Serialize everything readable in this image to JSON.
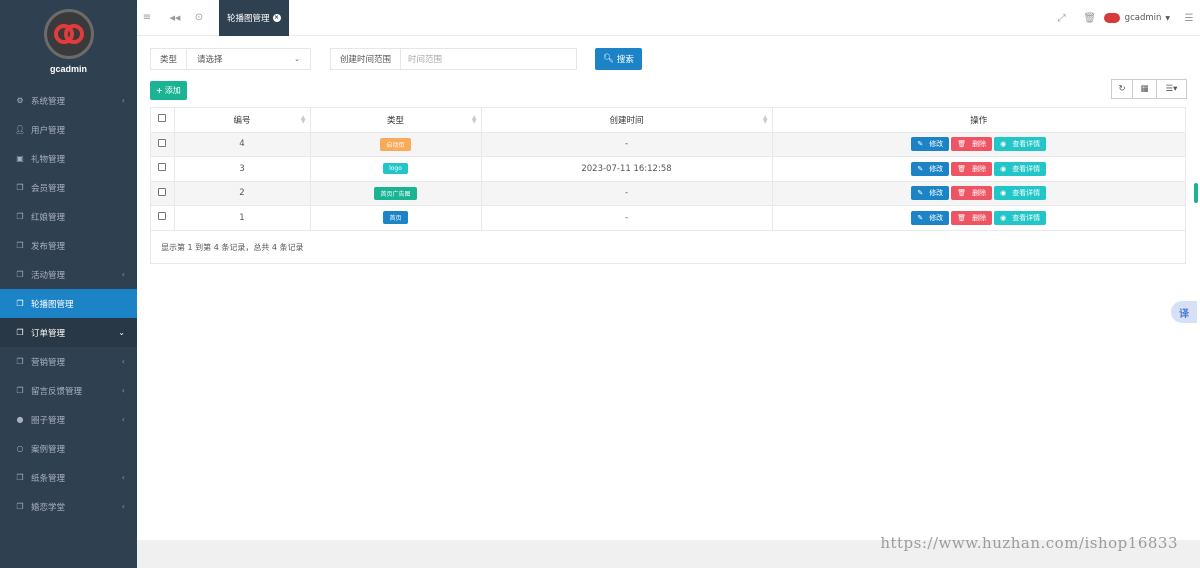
{
  "brand": {
    "name": "gcadmin"
  },
  "colors": {
    "sidebar": "#2f4050",
    "primary": "#1c84c6",
    "success": "#1ab394",
    "danger": "#ed5565",
    "info": "#23c6c8",
    "warning": "#f8ac59"
  },
  "sidebar": {
    "items": [
      {
        "label": "系统管理",
        "icon": "gears-icon",
        "caret": "‹"
      },
      {
        "label": "用户管理",
        "icon": "user-icon",
        "caret": ""
      },
      {
        "label": "礼物管理",
        "icon": "gift-icon",
        "caret": ""
      },
      {
        "label": "会员管理",
        "icon": "copy-icon",
        "caret": ""
      },
      {
        "label": "红娘管理",
        "icon": "copy-icon",
        "caret": ""
      },
      {
        "label": "发布管理",
        "icon": "copy-icon",
        "caret": ""
      },
      {
        "label": "活动管理",
        "icon": "copy-icon",
        "caret": "‹"
      },
      {
        "label": "轮播图管理",
        "icon": "copy-icon",
        "caret": ""
      },
      {
        "label": "订单管理",
        "icon": "copy-icon",
        "caret": "⌄"
      },
      {
        "label": "营销管理",
        "icon": "copy-icon",
        "caret": "‹"
      },
      {
        "label": "留言反馈管理",
        "icon": "copy-icon",
        "caret": "‹"
      },
      {
        "label": "圈子管理",
        "icon": "globe-icon",
        "caret": "‹"
      },
      {
        "label": "案例管理",
        "icon": "circle-icon",
        "caret": ""
      },
      {
        "label": "纸条管理",
        "icon": "copy-icon",
        "caret": "‹"
      },
      {
        "label": "婚恋学堂",
        "icon": "copy-icon",
        "caret": "‹"
      }
    ]
  },
  "topbar": {
    "menu_icon": "≡",
    "back_icon": "◀◀",
    "refresh_icon": "⊙",
    "active_tab": "轮播图管理",
    "user": "gcadmin"
  },
  "search": {
    "type_label": "类型",
    "type_value": "请选择",
    "date_label": "创建时间范围",
    "date_placeholder": "时间范围",
    "search_button": "搜索"
  },
  "toolbar": {
    "add_button": "添加"
  },
  "table": {
    "headers": {
      "id": "编号",
      "type": "类型",
      "created": "创建时间",
      "actions": "操作"
    },
    "rows": [
      {
        "id": "4",
        "type": "启动页",
        "type_color": "#f8ac59",
        "created": "-"
      },
      {
        "id": "3",
        "type": "logo",
        "type_color": "#23c6c8",
        "created": "2023-07-11 16:12:58"
      },
      {
        "id": "2",
        "type": "首页广告图",
        "type_color": "#1ab394",
        "created": "-"
      },
      {
        "id": "1",
        "type": "首页",
        "type_color": "#1c84c6",
        "created": "-"
      }
    ],
    "action_labels": {
      "edit": "修改",
      "delete": "删除",
      "view": "查看详情"
    },
    "pagination_text": "显示第 1 到第 4 条记录，总共 4 条记录"
  },
  "translate_label": "译",
  "watermark": "https://www.huzhan.com/ishop16833"
}
